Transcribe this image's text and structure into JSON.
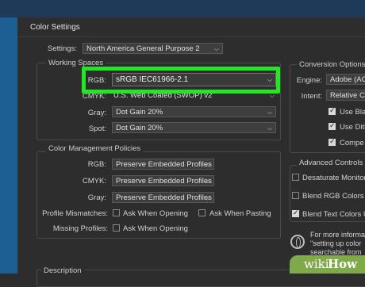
{
  "dialog": {
    "title": "Color Settings"
  },
  "settings": {
    "label": "Settings:",
    "value": "North America General Purpose 2"
  },
  "working_spaces": {
    "legend": "Working Spaces",
    "rgb": {
      "label": "RGB:",
      "value": "sRGB IEC61966-2.1"
    },
    "cmyk": {
      "label": "CMYK:",
      "value": "U.S. Web Coated (SWOP) v2"
    },
    "gray": {
      "label": "Gray:",
      "value": "Dot Gain 20%"
    },
    "spot": {
      "label": "Spot:",
      "value": "Dot Gain 20%"
    }
  },
  "policies": {
    "legend": "Color Management Policies",
    "rgb": {
      "label": "RGB:",
      "value": "Preserve Embedded Profiles"
    },
    "cmyk": {
      "label": "CMYK:",
      "value": "Preserve Embedded Profiles"
    },
    "gray": {
      "label": "Gray:",
      "value": "Preserve Embedded Profiles"
    },
    "mismatches": {
      "label": "Profile Mismatches:",
      "opt1": "Ask When Opening",
      "opt2": "Ask When Pasting"
    },
    "missing": {
      "label": "Missing Profiles:",
      "opt1": "Ask When Opening"
    }
  },
  "conversion": {
    "legend": "Conversion Options",
    "engine": {
      "label": "Engine:",
      "value": "Adobe (AC"
    },
    "intent": {
      "label": "Intent:",
      "value": "Relative Co"
    },
    "checks": [
      "Use Bla",
      "Use Dith",
      "Compe"
    ]
  },
  "advanced": {
    "legend": "Advanced Controls",
    "desaturate": "Desaturate Monitor",
    "blend_rgb": "Blend RGB Colors U",
    "blend_text": "Blend Text Colors U"
  },
  "info": {
    "line1": "For more informa",
    "line2": "\"setting up color",
    "line3": "searchable from"
  },
  "description": {
    "legend": "Description"
  },
  "watermark": {
    "wiki": "wiki",
    "how": "How"
  },
  "colors": {
    "highlight": "#22e823",
    "dialog_bg": "#2d2d2d",
    "desktop_blue": "#1d5f93"
  }
}
